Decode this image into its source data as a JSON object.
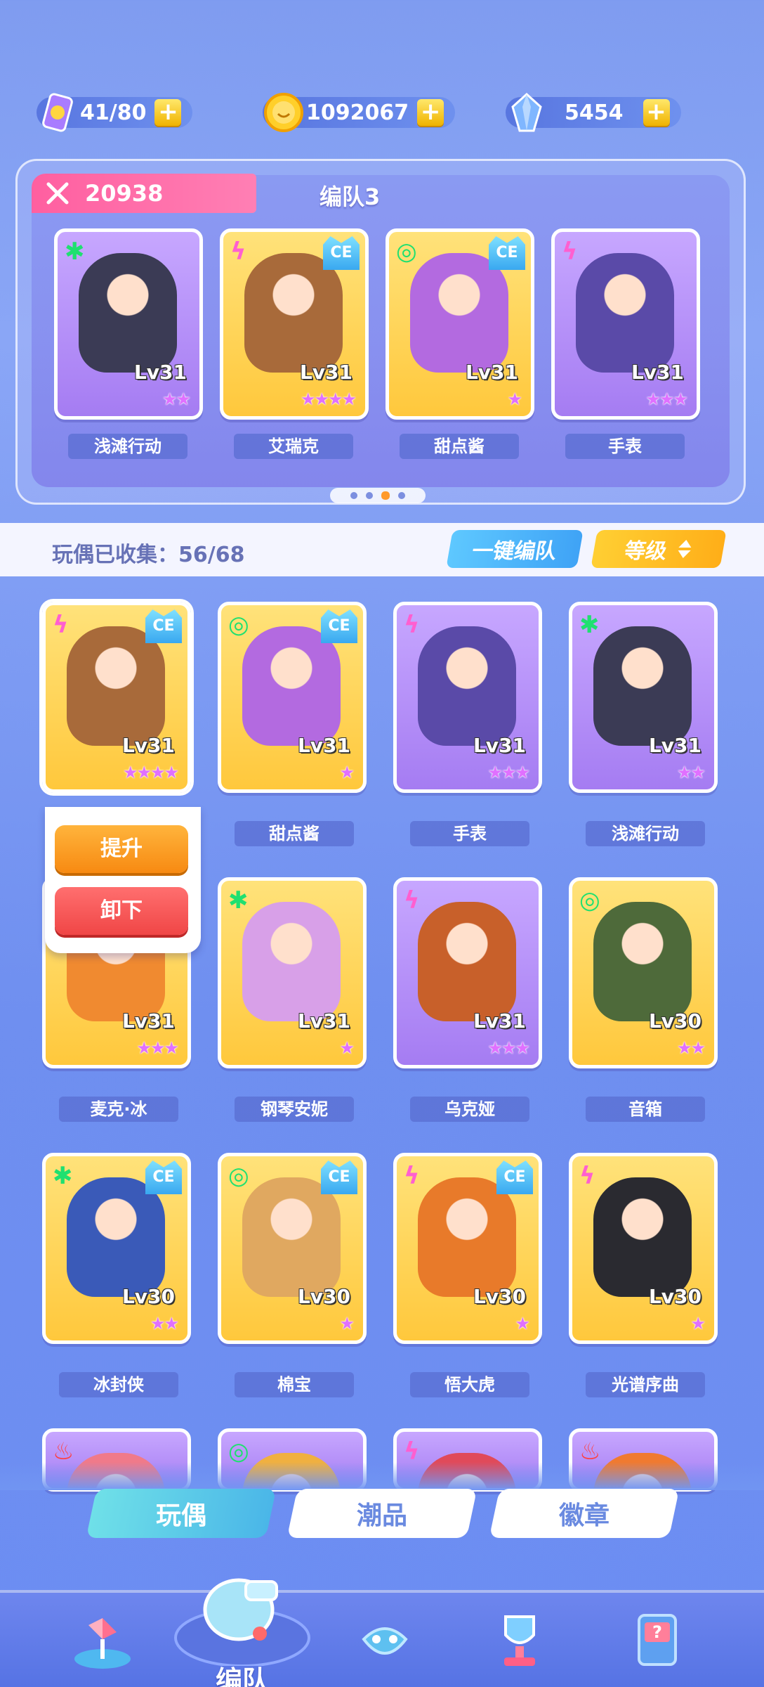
{
  "resources": {
    "stamina": {
      "value": "41/80",
      "icon": "stamina-card-icon"
    },
    "coins": {
      "value": "1092067",
      "icon": "coin-icon"
    },
    "gems": {
      "value": "5454",
      "icon": "crystal-icon"
    }
  },
  "formation": {
    "power": "20938",
    "title": "编队3",
    "members": [
      {
        "name": "浅滩行动",
        "level": "Lv31",
        "stars": "★★",
        "element": "✱",
        "ce": false,
        "theme": "purple",
        "color": "#3b3b55"
      },
      {
        "name": "艾瑞克",
        "level": "Lv31",
        "stars": "★★★★",
        "element": "ϟ",
        "ce": true,
        "ce_label": "CE",
        "theme": "yellow",
        "color": "#a86a3a"
      },
      {
        "name": "甜点酱",
        "level": "Lv31",
        "stars": "★",
        "element": "◎",
        "ce": true,
        "ce_label": "CE",
        "theme": "yellow",
        "color": "#b36ae0"
      },
      {
        "name": "手表",
        "level": "Lv31",
        "stars": "★★★",
        "element": "ϟ",
        "ce": false,
        "theme": "purple",
        "color": "#5a4aa8"
      }
    ]
  },
  "collection": {
    "label": "玩偶已收集：56/68",
    "auto_button": "一键编队",
    "sort_button": "等级",
    "sort_icon": "sort-arrows-icon"
  },
  "popup": {
    "upgrade": "提升",
    "unequip": "卸下"
  },
  "cards": [
    {
      "name": "艾瑞克",
      "level": "Lv31",
      "stars": "★★★★",
      "element": "ϟ",
      "ce": true,
      "ce_label": "CE",
      "theme": "yellow",
      "color": "#a86a3a",
      "selected": true
    },
    {
      "name": "甜点酱",
      "level": "Lv31",
      "stars": "★",
      "element": "◎",
      "ce": true,
      "ce_label": "CE",
      "theme": "yellow",
      "color": "#b36ae0"
    },
    {
      "name": "手表",
      "level": "Lv31",
      "stars": "★★★",
      "element": "ϟ",
      "ce": false,
      "theme": "purple",
      "color": "#5a4aa8"
    },
    {
      "name": "浅滩行动",
      "level": "Lv31",
      "stars": "★★",
      "element": "✱",
      "ce": false,
      "theme": "purple",
      "color": "#3b3b55"
    },
    {
      "name": "麦克·冰",
      "level": "Lv31",
      "stars": "★★★",
      "element": "",
      "ce": false,
      "theme": "yellow",
      "color": "#f08a30"
    },
    {
      "name": "钢琴安妮",
      "level": "Lv31",
      "stars": "★",
      "element": "✱",
      "ce": false,
      "theme": "yellow",
      "color": "#d8a0e8"
    },
    {
      "name": "乌克娅",
      "level": "Lv31",
      "stars": "★★★",
      "element": "ϟ",
      "ce": false,
      "theme": "purple",
      "color": "#c8602a"
    },
    {
      "name": "音箱",
      "level": "Lv30",
      "stars": "★★",
      "element": "◎",
      "ce": false,
      "theme": "yellow",
      "color": "#4e6a3a"
    },
    {
      "name": "冰封侠",
      "level": "Lv30",
      "stars": "★★",
      "element": "✱",
      "ce": true,
      "ce_label": "CE",
      "theme": "yellow",
      "color": "#3a5ab8"
    },
    {
      "name": "棉宝",
      "level": "Lv30",
      "stars": "★",
      "element": "◎",
      "ce": true,
      "ce_label": "CE",
      "theme": "yellow",
      "color": "#e0a860"
    },
    {
      "name": "悟大虎",
      "level": "Lv30",
      "stars": "★",
      "element": "ϟ",
      "ce": true,
      "ce_label": "CE",
      "theme": "yellow",
      "color": "#e87a2a"
    },
    {
      "name": "光谱序曲",
      "level": "Lv30",
      "stars": "★",
      "element": "ϟ",
      "ce": false,
      "theme": "yellow",
      "color": "#2a2a30"
    }
  ],
  "partial_row": [
    {
      "element": "♨",
      "theme": "purple",
      "color": "#f07a8a"
    },
    {
      "element": "◎",
      "theme": "purple",
      "color": "#f0b040"
    },
    {
      "element": "ϟ",
      "theme": "purple",
      "color": "#e04a5a"
    },
    {
      "element": "♨",
      "theme": "purple",
      "color": "#f07a30"
    }
  ],
  "tabs": [
    {
      "label": "玩偶",
      "active": true
    },
    {
      "label": "潮品",
      "active": false
    },
    {
      "label": "徽章",
      "active": false
    }
  ],
  "nav": {
    "items": [
      {
        "icon": "pinwheel-icon"
      },
      {
        "icon": "formation-whistle-icon",
        "label": "编队",
        "active": true
      },
      {
        "icon": "gamepad-icon"
      },
      {
        "icon": "trophy-icon"
      },
      {
        "icon": "question-box-icon"
      }
    ]
  },
  "colors": {
    "accent_pink": "#ff5fa0",
    "accent_blue": "#4ab6e8",
    "accent_yellow": "#ffae18",
    "element_color": "#1fe070"
  }
}
